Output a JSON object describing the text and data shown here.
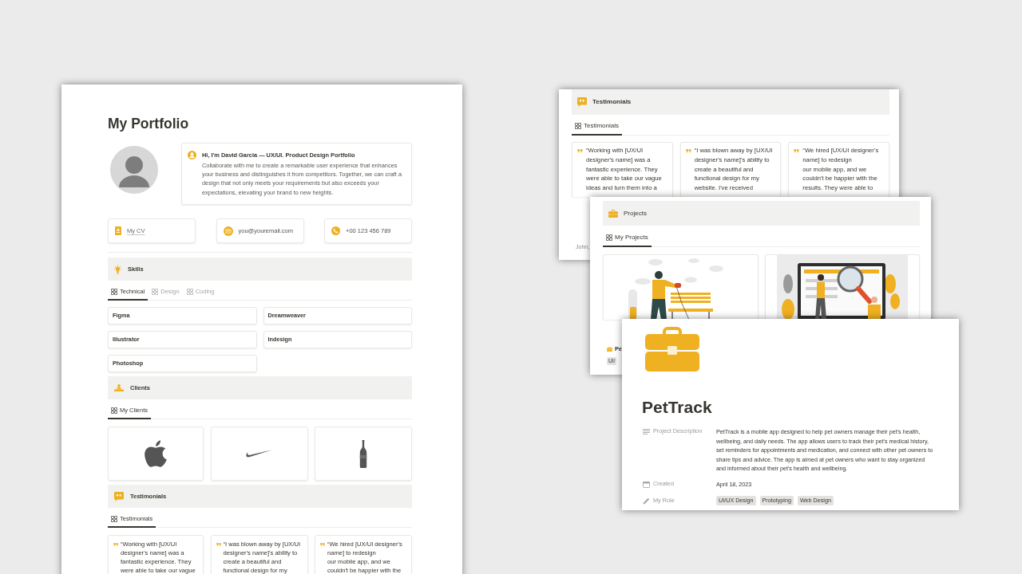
{
  "portfolio_page": {
    "title": "My Portfolio",
    "intro": {
      "heading": "Hi, I'm David Garcia — UX/UI. Product Design Portfolio",
      "text": "Collaborate with me to create a remarkable user experience that enhances your business and distinguishes it from competitors. Together, we can craft a design that not only meets your requirements but also exceeds your expectations, elevating your brand to new heights."
    },
    "contacts": [
      {
        "kind": "file",
        "label": "My CV"
      },
      {
        "kind": "email",
        "label": "you@youremail.com"
      },
      {
        "kind": "phone",
        "label": "+00 123 456 789"
      }
    ],
    "sections": [
      {
        "kind": "skills",
        "title": "Skills",
        "tabs": [
          {
            "label": "Technical",
            "selected": true
          },
          {
            "label": "Design",
            "selected": false
          },
          {
            "label": "Coding",
            "selected": false
          }
        ],
        "items": [
          "Figma",
          "Dreamweaver",
          "Illustrator",
          "Indesign",
          "Photoshop"
        ]
      },
      {
        "kind": "clients",
        "title": "Clients",
        "tabs": [
          {
            "label": "My Clients",
            "selected": true
          }
        ]
      },
      {
        "kind": "testimonials",
        "title": "Testimonials",
        "tabs": [
          {
            "label": "Testimonials",
            "selected": true
          }
        ],
        "quotes": [
          {
            "text": "“Working with [UX/UI designer's name] was a fantastic experience. They were able to take our vague"
          },
          {
            "text": "“I was blown away by [UX/UI designer's name]'s ability to create a beautiful and functional design for my"
          },
          {
            "text": "“We hired [UX/UI designer's name] to redesign\nour mobile app, and we couldn't be happier with the"
          }
        ]
      }
    ]
  },
  "testimonials_window": {
    "title": "Testimonials",
    "tabs": [
      {
        "label": "Testimonials",
        "selected": true
      }
    ],
    "quotes": [
      {
        "text": "“Working with [UX/UI designer's name] was a fantastic experience. They were able to take our vague ideas and turn them into a"
      },
      {
        "text": "“I was blown away by [UX/UI designer's name]'s ability to create a beautiful and functional design for my website. I've received"
      },
      {
        "text": "“We hired [UX/UI designer's name] to redesign\nour mobile app, and we couldn't be happier with the results. They were able to"
      }
    ],
    "author": "John,"
  },
  "projects_window": {
    "title": "Projects",
    "tabs": [
      {
        "label": "My Projects",
        "selected": true
      }
    ],
    "cards": [
      {
        "kind": "walk"
      },
      {
        "kind": "screen"
      }
    ],
    "first_card_footer": {
      "name": "Pe",
      "tags": [
        "UI/"
      ]
    }
  },
  "project_page": {
    "title": "PetTrack",
    "properties": [
      {
        "kind": "text",
        "label": "Project Description",
        "value": "PetTrack is a mobile app designed to help pet owners manage their pet's health, wellbeing, and daily needs. The app allows users to track their pet's medical history, set reminders for appointments and medication, and connect with other pet owners to share tips and advice. The app is aimed at pet owners who want to stay organized and informed about their pet's health and wellbeing."
      },
      {
        "kind": "date",
        "label": "Created",
        "value": "April 18, 2023"
      },
      {
        "kind": "tags",
        "label": "My Role",
        "tags": [
          "UI/UX Design",
          "Prototyping",
          "Web Design"
        ]
      }
    ]
  }
}
